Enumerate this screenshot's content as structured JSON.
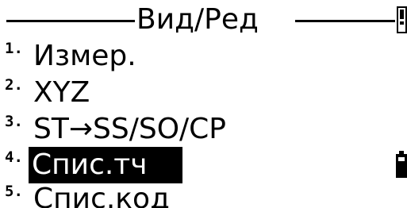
{
  "screen": {
    "title": "Вид/Ред",
    "menu": [
      {
        "num": "1.",
        "label": "Измер."
      },
      {
        "num": "2.",
        "label": "XYZ"
      },
      {
        "num": "3.",
        "label": "ST→SS/SO/CP"
      },
      {
        "num": "4.",
        "label": "Спис.тч",
        "selected": true
      },
      {
        "num": "5.",
        "label": "Спис.код"
      }
    ]
  },
  "colors": {
    "foreground": "#000000",
    "background": "#ffffff",
    "selection_bg": "#000000",
    "selection_fg": "#ffffff"
  },
  "icons": {
    "top_right": "scroll-bar-icon",
    "right_side": "battery-icon"
  }
}
